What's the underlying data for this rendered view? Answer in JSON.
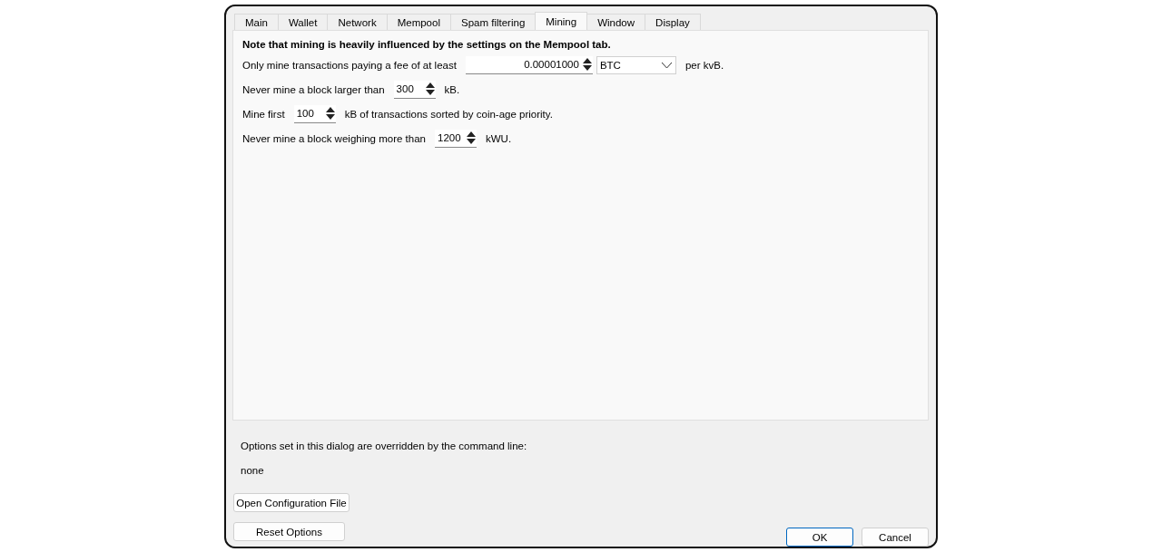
{
  "tabs": [
    {
      "label": "Main",
      "selected": false
    },
    {
      "label": "Wallet",
      "selected": false
    },
    {
      "label": "Network",
      "selected": false
    },
    {
      "label": "Mempool",
      "selected": false
    },
    {
      "label": "Spam filtering",
      "selected": false
    },
    {
      "label": "Mining",
      "selected": true
    },
    {
      "label": "Window",
      "selected": false
    },
    {
      "label": "Display",
      "selected": false
    }
  ],
  "note": "Note that mining is heavily influenced by the settings on the Mempool tab.",
  "rows": [
    {
      "parts": [
        {
          "kind": "text",
          "text": "Only mine transactions paying a fee of at least"
        },
        {
          "kind": "wide_spin",
          "value": "0.00001000"
        },
        {
          "kind": "select",
          "value": "BTC"
        },
        {
          "kind": "text",
          "text": "per kvB."
        }
      ]
    },
    {
      "parts": [
        {
          "kind": "text",
          "text": "Never mine a block larger than"
        },
        {
          "kind": "spin",
          "value": "300"
        },
        {
          "kind": "text",
          "text": "kB."
        }
      ]
    },
    {
      "parts": [
        {
          "kind": "text",
          "text": "Mine first"
        },
        {
          "kind": "spin",
          "value": "100"
        },
        {
          "kind": "text",
          "text": "kB of transactions sorted by coin-age priority."
        }
      ]
    },
    {
      "parts": [
        {
          "kind": "text",
          "text": "Never mine a block weighing more than"
        },
        {
          "kind": "spin",
          "value": "1200"
        },
        {
          "kind": "text",
          "text": "kWU."
        }
      ]
    }
  ],
  "override_label": "Options set in this dialog are overridden by the command line:",
  "override_value": "none",
  "buttons": {
    "open_config": "Open Configuration File",
    "reset": "Reset Options",
    "ok": "OK",
    "cancel": "Cancel"
  }
}
